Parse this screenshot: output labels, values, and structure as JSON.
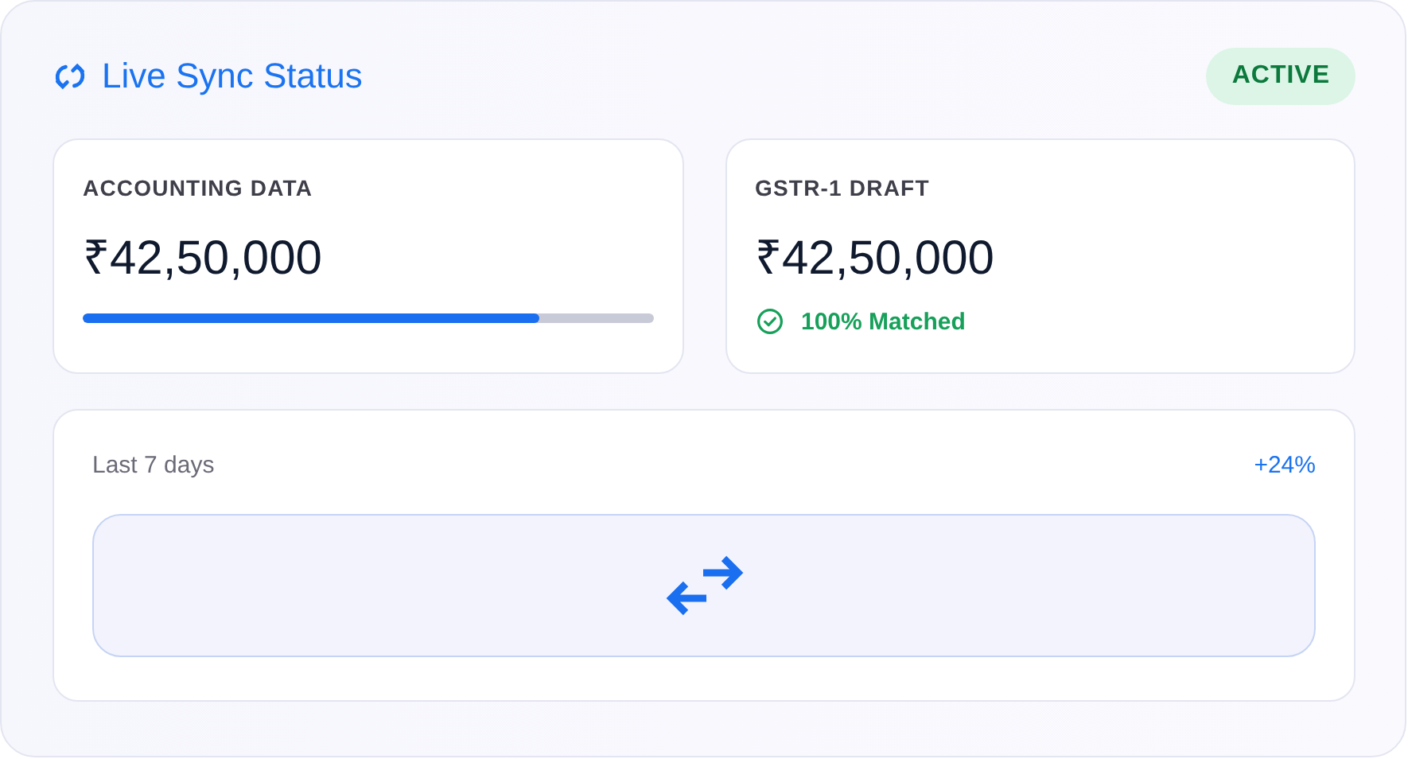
{
  "header": {
    "title": "Live Sync Status",
    "badge": "ACTIVE"
  },
  "metrics": [
    {
      "kind": "progress",
      "label": "ACCOUNTING DATA",
      "value": "₹42,50,000",
      "level": 0.8
    },
    {
      "kind": "match",
      "label": "GSTR-1 DRAFT",
      "value": "₹42,50,000",
      "note": "100% Matched"
    }
  ],
  "trend": {
    "period": "Last 7 days",
    "change": "+24%"
  }
}
